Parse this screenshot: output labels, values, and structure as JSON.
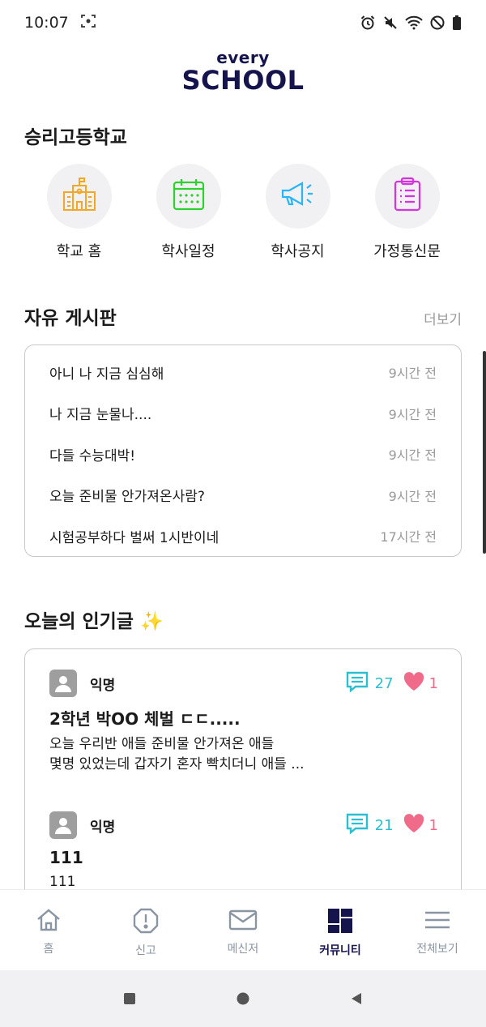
{
  "status_bar": {
    "time": "10:07"
  },
  "logo": {
    "top": "every",
    "bottom": "SCHOOL"
  },
  "school": {
    "name": "승리고등학교"
  },
  "quick_menu": [
    {
      "label": "학교 홈",
      "icon": "school-building-icon",
      "color": "#f5a623"
    },
    {
      "label": "학사일정",
      "icon": "calendar-icon",
      "color": "#2ed12e"
    },
    {
      "label": "학사공지",
      "icon": "megaphone-icon",
      "color": "#29b6f6"
    },
    {
      "label": "가정통신문",
      "icon": "clipboard-icon",
      "color": "#d633e0"
    }
  ],
  "free_board": {
    "title": "자유 게시판",
    "more": "더보기",
    "posts": [
      {
        "title": "아니 나 지금 심심해",
        "time": "9시간 전"
      },
      {
        "title": "나 지금 눈물나....",
        "time": "9시간 전"
      },
      {
        "title": "다들 수능대박!",
        "time": "9시간 전"
      },
      {
        "title": "오늘 준비물 안가져온사람?",
        "time": "9시간 전"
      },
      {
        "title": "시험공부하다 벌써 1시반이네",
        "time": "17시간 전"
      }
    ]
  },
  "popular": {
    "title": "오늘의 인기글 ✨",
    "posts": [
      {
        "author": "익명",
        "comments": "27",
        "likes": "1",
        "title": "2학년 박OO 체벌 ㄷㄷ.....",
        "body_line1": "오늘 우리반 애들 준비물 안가져온 애들",
        "body_line2": "몇명 있었는데 갑자기 혼자 빡치더니 애들 ..."
      },
      {
        "author": "익명",
        "comments": "21",
        "likes": "1",
        "title": "111",
        "body_line1": "111",
        "body_line2": ""
      }
    ]
  },
  "bottom_nav": [
    {
      "label": "홈",
      "icon": "home-icon",
      "active": false
    },
    {
      "label": "신고",
      "icon": "alert-icon",
      "active": false
    },
    {
      "label": "메신저",
      "icon": "mail-icon",
      "active": false
    },
    {
      "label": "커뮤니티",
      "icon": "community-grid-icon",
      "active": true
    },
    {
      "label": "전체보기",
      "icon": "menu-icon",
      "active": false
    }
  ],
  "colors": {
    "brand": "#16144d",
    "comment": "#2bbfcf",
    "like": "#f06b8a",
    "muted": "#9a9a9a"
  }
}
